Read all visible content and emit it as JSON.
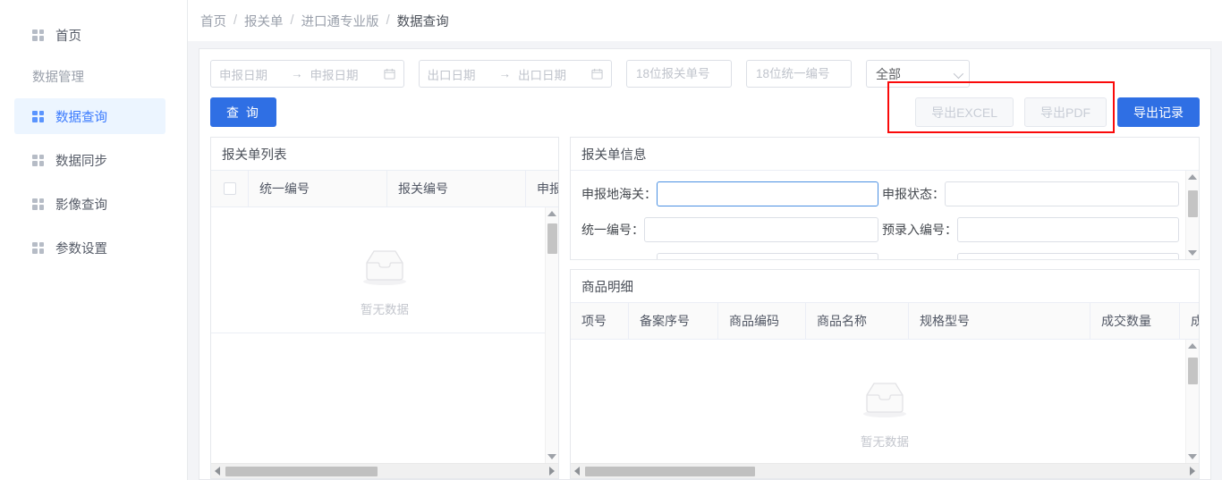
{
  "sidebar": {
    "items": [
      {
        "label": "首页",
        "icon": "grid-icon",
        "type": "item",
        "active": false
      },
      {
        "label": "数据管理",
        "icon": "",
        "type": "group",
        "active": false
      },
      {
        "label": "数据查询",
        "icon": "grid-icon",
        "type": "item",
        "active": true
      },
      {
        "label": "数据同步",
        "icon": "grid-icon",
        "type": "item",
        "active": false
      },
      {
        "label": "影像查询",
        "icon": "grid-icon",
        "type": "item",
        "active": false
      },
      {
        "label": "参数设置",
        "icon": "grid-icon",
        "type": "item",
        "active": false
      }
    ]
  },
  "breadcrumb": {
    "items": [
      "首页",
      "报关单",
      "进口通专业版",
      "数据查询"
    ],
    "separator": "/"
  },
  "filters": {
    "declare_date": {
      "start_placeholder": "申报日期",
      "end_placeholder": "申报日期",
      "arrow": "→",
      "icon": "calendar-icon"
    },
    "export_date": {
      "start_placeholder": "出口日期",
      "end_placeholder": "出口日期",
      "arrow": "→",
      "icon": "calendar-icon"
    },
    "customs_no_placeholder": "18位报关单号",
    "unified_no_placeholder": "18位统一编号",
    "status_select": {
      "value": "全部",
      "icon": "chevron-down-icon"
    }
  },
  "toolbar": {
    "query_label": "查 询",
    "export_excel_label": "导出EXCEL",
    "export_excel_disabled": true,
    "export_pdf_label": "导出PDF",
    "export_pdf_disabled": true,
    "export_record_label": "导出记录",
    "annotation_color": "#fa0a0a"
  },
  "left_panel": {
    "title": "报关单列表",
    "columns": [
      "统一编号",
      "报关编号",
      "申报日"
    ],
    "checkbox_column": true,
    "empty": {
      "text": "暂无数据",
      "icon": "empty-box-icon"
    }
  },
  "detail_panel": {
    "title": "报关单信息",
    "rows": [
      {
        "fields": [
          {
            "label": "申报地海关：",
            "value": "",
            "focused": true
          },
          {
            "label": "申报状态：",
            "value": "",
            "focused": false
          }
        ]
      },
      {
        "fields": [
          {
            "label": "统一编号：",
            "value": "",
            "focused": false
          },
          {
            "label": "预录入编号：",
            "value": "",
            "focused": false
          }
        ]
      },
      {
        "fields": [
          {
            "label": "",
            "value": "",
            "focused": false
          },
          {
            "label": "",
            "value": "",
            "focused": false
          }
        ]
      }
    ]
  },
  "goods_panel": {
    "title": "商品明细",
    "columns": [
      "项号",
      "备案序号",
      "商品编码",
      "商品名称",
      "规格型号",
      "成交数量",
      "成"
    ],
    "empty": {
      "text": "暂无数据",
      "icon": "empty-box-icon"
    }
  },
  "colors": {
    "primary": "#2f6fe4",
    "active_nav_bg": "#ecf5ff",
    "active_nav_text": "#3a7afe",
    "annotation": "#fa0a0a"
  }
}
